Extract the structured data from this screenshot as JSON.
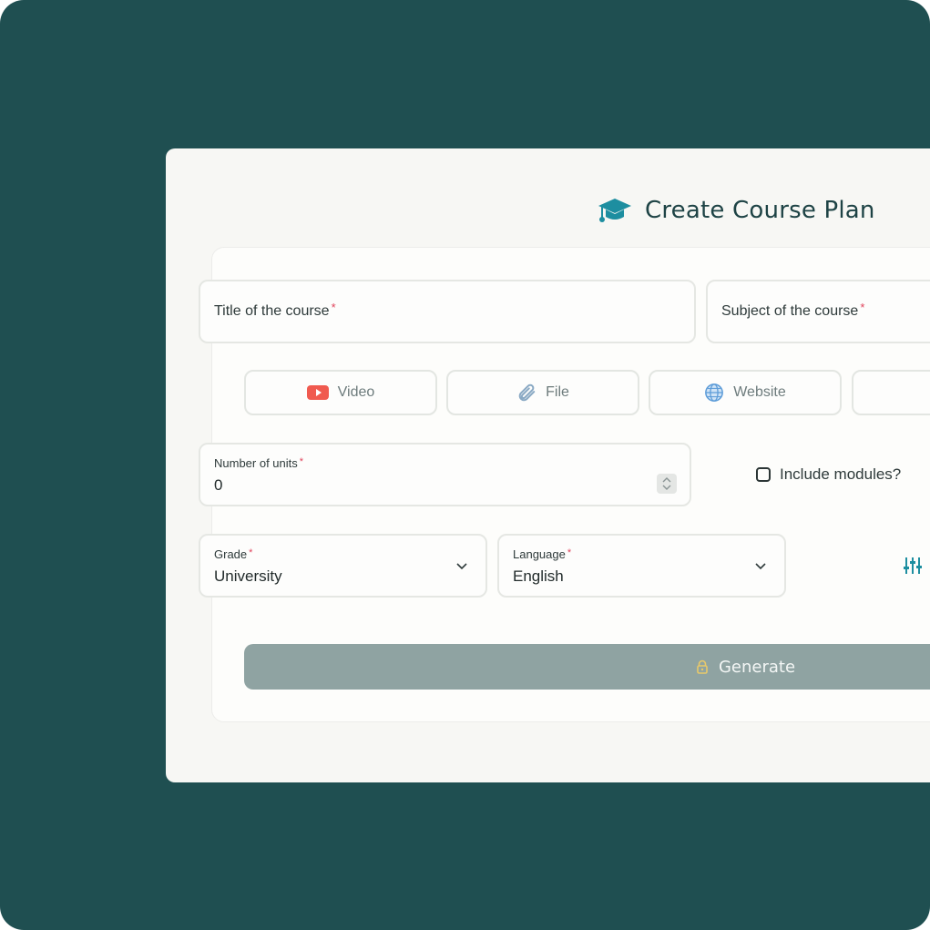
{
  "header": {
    "title": "Create Course Plan",
    "icon": "graduation-cap-icon"
  },
  "form": {
    "course_title": {
      "placeholder": "Title of the course",
      "required_mark": "*"
    },
    "course_subject": {
      "placeholder": "Subject of the course",
      "required_mark": "*"
    },
    "sources": [
      {
        "label": "Video",
        "icon": "youtube-icon",
        "color": "#f05a4f"
      },
      {
        "label": "File",
        "icon": "paperclip-icon",
        "color": "#8aa9c4"
      },
      {
        "label": "Website",
        "icon": "globe-icon",
        "color": "#5b9bd8"
      },
      {
        "label": "",
        "icon": "document-icon",
        "color": "#e1c443"
      }
    ],
    "units": {
      "label": "Number of units",
      "required_mark": "*",
      "value": "0"
    },
    "include_modules": {
      "label": "Include modules?",
      "checked": false
    },
    "grade": {
      "label": "Grade",
      "required_mark": "*",
      "value": "University"
    },
    "language": {
      "label": "Language",
      "required_mark": "*",
      "value": "English"
    },
    "settings_icon": "sliders-icon",
    "generate": {
      "label": "Generate",
      "icon": "lock-icon",
      "disabled": true
    }
  },
  "colors": {
    "background": "#1f4f51",
    "panel": "#f7f7f4",
    "accent": "#1d8ea0",
    "generate_button": "#8fa3a2",
    "required": "#e0445c"
  }
}
